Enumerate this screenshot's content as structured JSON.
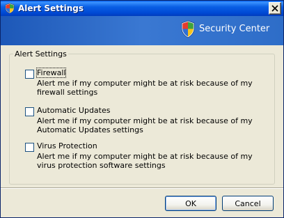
{
  "window": {
    "title": "Alert Settings",
    "title_icon": "security-shield-icon",
    "close_icon": "close-icon"
  },
  "banner": {
    "text": "Security Center",
    "icon": "security-shield-icon",
    "colors": {
      "start": "#1d58b8",
      "end": "#2e6dc8"
    }
  },
  "group": {
    "label": "Alert Settings",
    "options": [
      {
        "title": "Firewall",
        "description": "Alert me if my computer might be at risk because of my firewall settings",
        "checked": false
      },
      {
        "title": "Automatic Updates",
        "description": "Alert me if my computer might be at risk because of my Automatic Updates settings",
        "checked": false
      },
      {
        "title": "Virus Protection",
        "description": "Alert me if my computer might be at risk because of my virus protection software settings",
        "checked": false
      }
    ]
  },
  "buttons": {
    "ok": "OK",
    "cancel": "Cancel"
  }
}
